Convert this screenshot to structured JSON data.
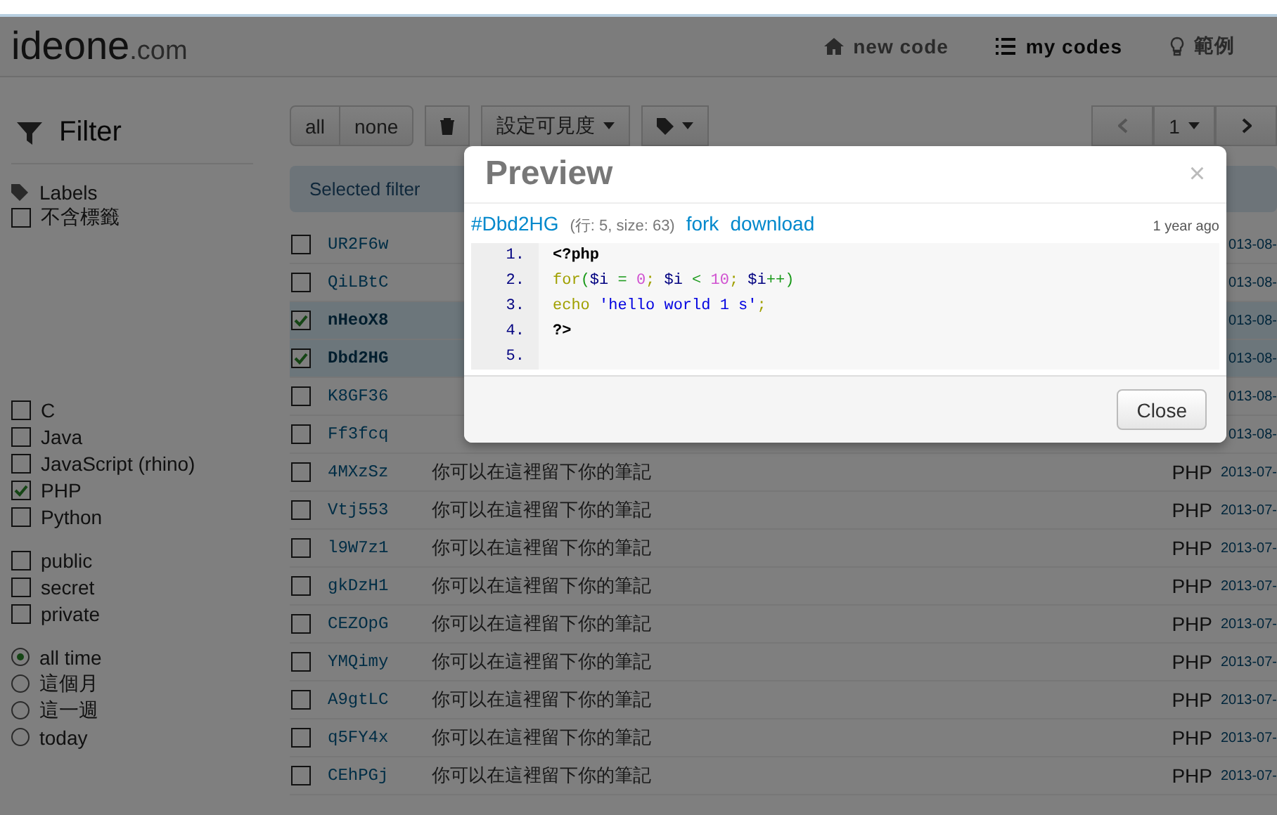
{
  "navbar": {
    "logo_main": "ideone",
    "logo_suffix": ".com",
    "links": [
      {
        "label": "new code",
        "selected": false
      },
      {
        "label": "my codes",
        "selected": true
      },
      {
        "label": "範例",
        "selected": false
      }
    ]
  },
  "sidebar": {
    "title": "Filter",
    "labels_heading": "Labels",
    "label_options": [
      {
        "label": "不含標籤",
        "checked": false
      }
    ],
    "languages": [
      {
        "label": "C",
        "checked": false
      },
      {
        "label": "Java",
        "checked": false
      },
      {
        "label": "JavaScript (rhino)",
        "checked": false
      },
      {
        "label": "PHP",
        "checked": true
      },
      {
        "label": "Python",
        "checked": false
      }
    ],
    "visibility": [
      {
        "label": "public",
        "checked": false
      },
      {
        "label": "secret",
        "checked": false
      },
      {
        "label": "private",
        "checked": false
      }
    ],
    "periods": [
      {
        "label": "all time",
        "selected": true
      },
      {
        "label": "這個月",
        "selected": false
      },
      {
        "label": "這一週",
        "selected": false
      },
      {
        "label": "today",
        "selected": false
      }
    ]
  },
  "toolbar": {
    "select_all": "all",
    "select_none": "none",
    "visibility_menu": "設定可見度",
    "page": "1"
  },
  "selected_filters": "Selected filter",
  "rows": [
    {
      "id": "UR2F6w",
      "checked": false,
      "date": "013-08-"
    },
    {
      "id": "QiLBtC",
      "checked": false,
      "date": "013-08-"
    },
    {
      "id": "nHeoX8",
      "checked": true,
      "date": "013-08-"
    },
    {
      "id": "Dbd2HG",
      "checked": true,
      "date": "013-08-"
    },
    {
      "id": "K8GF36",
      "checked": false,
      "date": "013-08-"
    },
    {
      "id": "Ff3fcq",
      "checked": false,
      "date": "013-08-"
    },
    {
      "id": "4MXzSz",
      "checked": false,
      "note": "你可以在這裡留下你的筆記",
      "language": "PHP",
      "date": "2013-07-"
    },
    {
      "id": "Vtj553",
      "checked": false,
      "note": "你可以在這裡留下你的筆記",
      "language": "PHP",
      "date": "2013-07-"
    },
    {
      "id": "l9W7z1",
      "checked": false,
      "note": "你可以在這裡留下你的筆記",
      "language": "PHP",
      "date": "2013-07-"
    },
    {
      "id": "gkDzH1",
      "checked": false,
      "note": "你可以在這裡留下你的筆記",
      "language": "PHP",
      "date": "2013-07-"
    },
    {
      "id": "CEZOpG",
      "checked": false,
      "note": "你可以在這裡留下你的筆記",
      "language": "PHP",
      "date": "2013-07-"
    },
    {
      "id": "YMQimy",
      "checked": false,
      "note": "你可以在這裡留下你的筆記",
      "language": "PHP",
      "date": "2013-07-"
    },
    {
      "id": "A9gtLC",
      "checked": false,
      "note": "你可以在這裡留下你的筆記",
      "language": "PHP",
      "date": "2013-07-"
    },
    {
      "id": "q5FY4x",
      "checked": false,
      "note": "你可以在這裡留下你的筆記",
      "language": "PHP",
      "date": "2013-07-"
    },
    {
      "id": "CEhPGj",
      "checked": false,
      "note": "你可以在這裡留下你的筆記",
      "language": "PHP",
      "date": "2013-07-"
    }
  ],
  "modal": {
    "title": "Preview",
    "close_glyph": "×",
    "code_link": "#Dbd2HG",
    "meta": "(行: 5, size: 63)",
    "fork": "fork",
    "download": "download",
    "age": "1 year ago",
    "lines": [
      {
        "number": "1.",
        "tokens": [
          {
            "text": "<?php",
            "kind": "tag"
          }
        ]
      },
      {
        "number": "2.",
        "tokens": [
          {
            "text": "for",
            "kind": "keyword"
          },
          {
            "text": "(",
            "kind": "op"
          },
          {
            "text": "$i",
            "kind": "var"
          },
          {
            "text": " = ",
            "kind": "op"
          },
          {
            "text": "0",
            "kind": "number"
          },
          {
            "text": "; ",
            "kind": "keyword"
          },
          {
            "text": "$i",
            "kind": "var"
          },
          {
            "text": " < ",
            "kind": "op"
          },
          {
            "text": "10",
            "kind": "number"
          },
          {
            "text": "; ",
            "kind": "keyword"
          },
          {
            "text": "$i",
            "kind": "var"
          },
          {
            "text": "++)",
            "kind": "op"
          }
        ]
      },
      {
        "number": "3.",
        "tokens": [
          {
            "text": "echo ",
            "kind": "keyword"
          },
          {
            "text": "'hello world 1 s'",
            "kind": "string"
          },
          {
            "text": ";",
            "kind": "keyword"
          }
        ]
      },
      {
        "number": "4.",
        "tokens": [
          {
            "text": "?>",
            "kind": "tag"
          }
        ]
      },
      {
        "number": "5."
      }
    ],
    "close_button": "Close"
  }
}
